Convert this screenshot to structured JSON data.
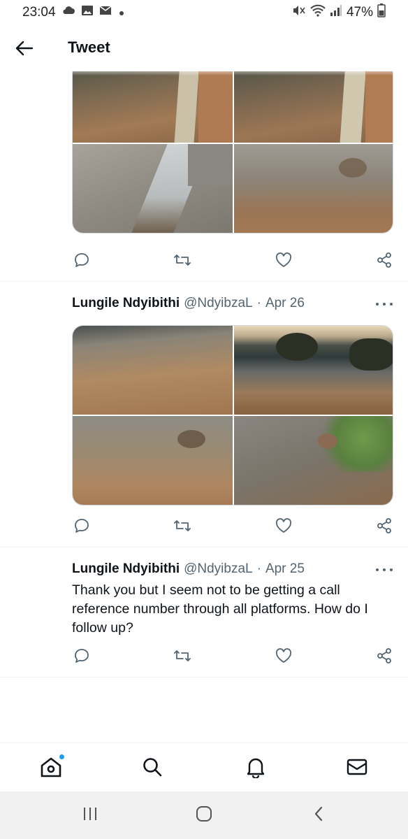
{
  "status_bar": {
    "time": "23:04",
    "battery": "47%",
    "icons_left": [
      "cloud-icon",
      "gallery-icon",
      "mail-icon",
      "dot-icon"
    ],
    "icons_right": [
      "mute-icon",
      "wifi-icon",
      "signal-icon",
      "battery-icon"
    ]
  },
  "header": {
    "title": "Tweet",
    "back_icon": "arrow-left-icon"
  },
  "tweets": [
    {
      "media_count": 4,
      "media_colors": [
        "#8a6a4a",
        "#7d6a52",
        "#9c9890",
        "#7f7668"
      ]
    },
    {
      "author": "Lungile Ndyibithi",
      "handle": "@NdyibzaL",
      "separator": "·",
      "date": "Apr 26",
      "media_count": 4,
      "media_colors": [
        "#a07650",
        "#6a5a4a",
        "#8c7256",
        "#7a6e5a"
      ]
    },
    {
      "author": "Lungile Ndyibithi",
      "handle": "@NdyibzaL",
      "separator": "·",
      "date": "Apr 25",
      "text": "Thank you but I seem not to be getting a call reference number through all platforms. How do I follow up?"
    }
  ],
  "tweet_actions": [
    "reply-icon",
    "retweet-icon",
    "like-icon",
    "share-icon"
  ],
  "bottom_nav": {
    "items": [
      "home-icon",
      "search-icon",
      "notifications-icon",
      "messages-icon"
    ],
    "home_has_badge": true
  },
  "android_nav": [
    "recents-icon",
    "home-icon",
    "back-icon"
  ],
  "colors": {
    "text_primary": "#0f1419",
    "text_secondary": "#536471",
    "accent": "#1d9bf0",
    "divider": "#eff3f4"
  }
}
